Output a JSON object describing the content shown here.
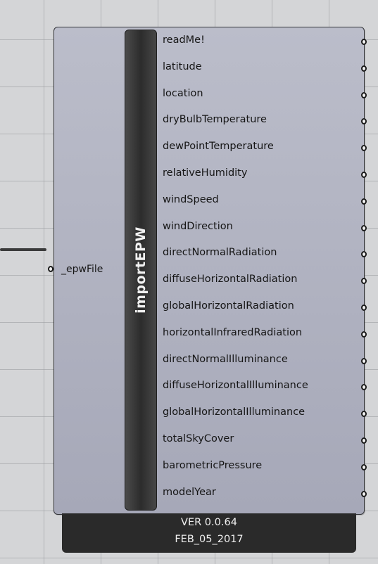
{
  "component": {
    "name": "importEPW",
    "input": {
      "label": "_epwFile"
    },
    "outputs": [
      {
        "label": "readMe!"
      },
      {
        "label": "latitude"
      },
      {
        "label": "location"
      },
      {
        "label": "dryBulbTemperature"
      },
      {
        "label": "dewPointTemperature"
      },
      {
        "label": "relativeHumidity"
      },
      {
        "label": "windSpeed"
      },
      {
        "label": "windDirection"
      },
      {
        "label": "directNormalRadiation"
      },
      {
        "label": "diffuseHorizontalRadiation"
      },
      {
        "label": "globalHorizontalRadiation"
      },
      {
        "label": "horizontalInfraredRadiation"
      },
      {
        "label": "directNormalIlluminance"
      },
      {
        "label": "diffuseHorizontalIlluminance"
      },
      {
        "label": "globalHorizontalIlluminance"
      },
      {
        "label": "totalSkyCover"
      },
      {
        "label": "barometricPressure"
      },
      {
        "label": "modelYear"
      }
    ],
    "version": "VER 0.0.64",
    "date": "FEB_05_2017"
  },
  "colors": {
    "canvas": "#d4d5d7",
    "component_body": "#b0b2c2",
    "name_bar": "#333333",
    "version_tag": "#2a2a2a"
  }
}
